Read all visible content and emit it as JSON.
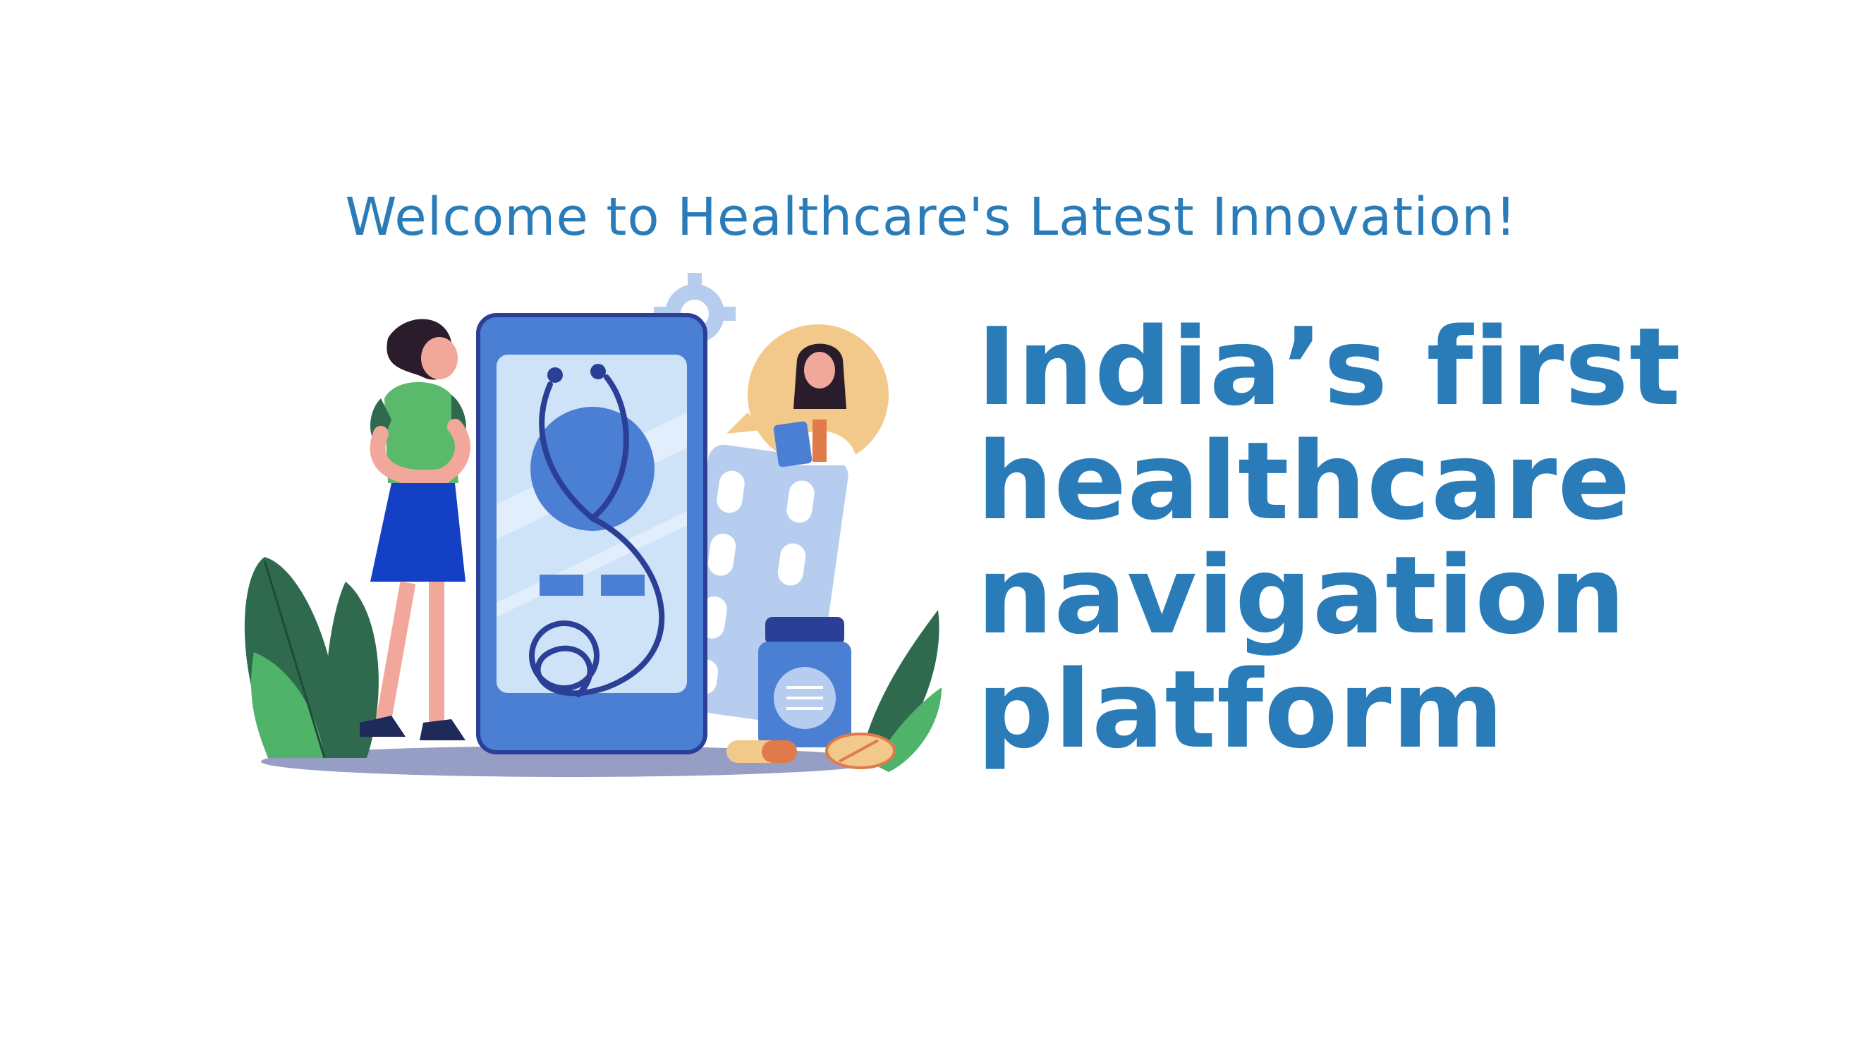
{
  "welcome_text": "Welcome to Healthcare's Latest Innovation!",
  "headline_lines": [
    "India’s first",
    "healthcare",
    "navigation",
    "platform"
  ],
  "illustration": {
    "icons": [
      "woman-patient",
      "smartphone",
      "stethoscope-icon",
      "gear-icon",
      "doctor-avatar",
      "pill-blister-pack",
      "medicine-bottle",
      "capsule",
      "tablet",
      "leaf"
    ]
  },
  "colors": {
    "heading": "#2a7cb8",
    "phone_frame": "#3a5bbf",
    "phone_screen": "#cfe3f8",
    "leaf_dark": "#2f6a4f",
    "leaf_light": "#4fb36a",
    "avatar_bg": "#f2c98a"
  }
}
